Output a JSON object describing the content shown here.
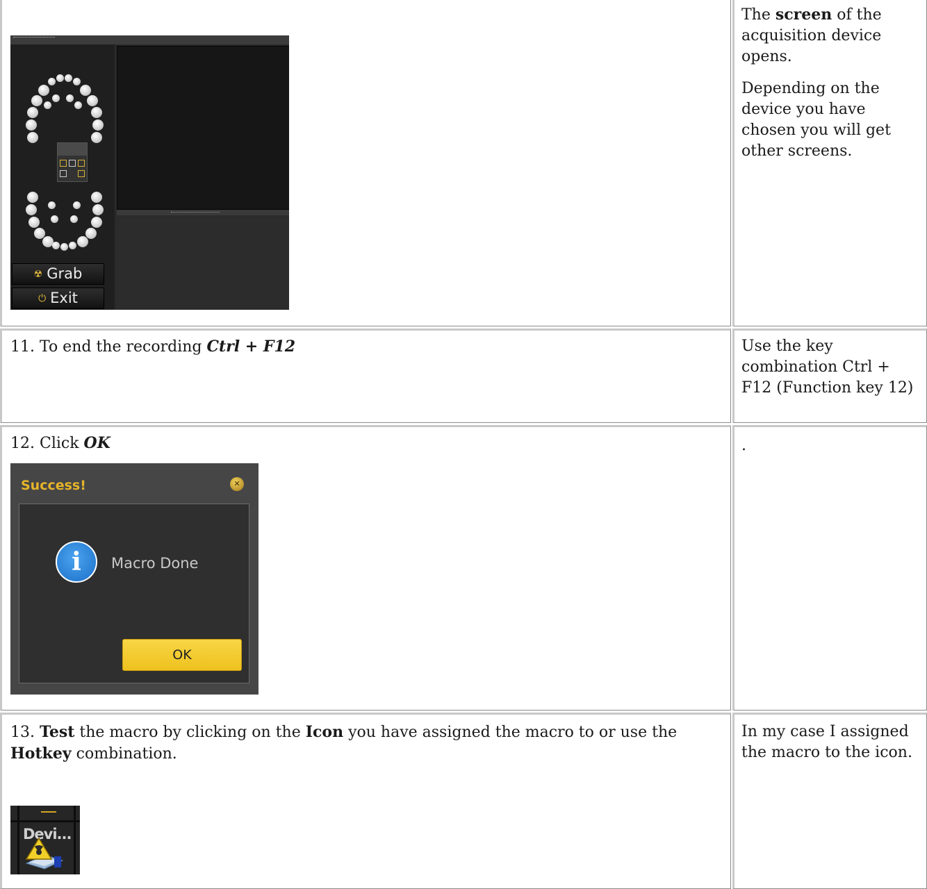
{
  "rows": [
    {
      "right": {
        "p1_pre": "The ",
        "p1_bold": "screen",
        "p1_post": " of the acquisition device opens.",
        "p2": "Depending on the device you have chosen you will get other screens."
      },
      "acquisition_screen": {
        "grab_label": "Grab",
        "exit_label": "Exit",
        "grab_icon": "radiation-icon",
        "exit_icon": "power-icon"
      }
    },
    {
      "left": {
        "step": "11. To end the recording ",
        "keys": "Ctrl + F12"
      },
      "right": {
        "text": "Use the key combination Ctrl + F12 (Function key 12)"
      }
    },
    {
      "left": {
        "step": "12. Click ",
        "action": "OK"
      },
      "right": {
        "text": "."
      },
      "dialog": {
        "title": "Success!",
        "message": "Macro Done",
        "ok_label": "OK",
        "close_icon": "close-icon",
        "info_icon": "info-icon",
        "accent": "#e6b42a"
      }
    },
    {
      "left": {
        "num": "13. ",
        "b1": "Test",
        "t1": " the macro by clicking on the ",
        "b2": "Icon",
        "t2": " you have assigned the macro to or use the ",
        "b3": "Hotkey",
        "t3": " combination."
      },
      "right": {
        "text": "In my case I assigned the macro to the icon."
      },
      "tile": {
        "label": "Devi...",
        "icon": "xray-device-icon"
      }
    }
  ]
}
